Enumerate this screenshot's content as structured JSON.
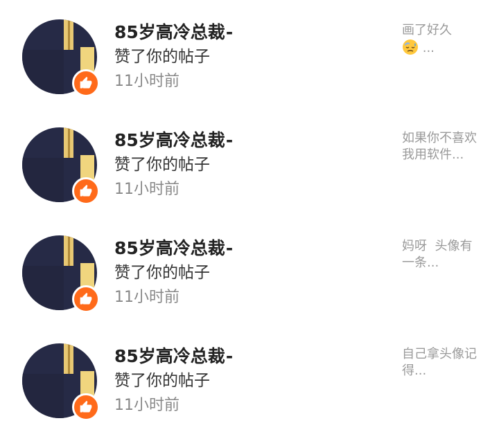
{
  "notifications": [
    {
      "user_name": "85岁高冷总裁⁃",
      "action": "赞了你的帖子",
      "time": "11小时前",
      "snippet_line1": "画了好久",
      "snippet_emoji": "sweat-face-icon",
      "snippet_tail": " ..."
    },
    {
      "user_name": "85岁高冷总裁⁃",
      "action": "赞了你的帖子",
      "time": "11小时前",
      "snippet_line1": "如果你不喜欢我用软件..."
    },
    {
      "user_name": "85岁高冷总裁⁃",
      "action": "赞了你的帖子",
      "time": "11小时前",
      "snippet_line1": "妈呀  头像有一条..."
    },
    {
      "user_name": "85岁高冷总裁⁃",
      "action": "赞了你的帖子",
      "time": "11小时前",
      "snippet_line1": "自己拿头像记得..."
    }
  ],
  "colors": {
    "badge": "#ff6a1a",
    "avatar_bg": "#262a46",
    "avatar_accent": "#e8c873"
  },
  "icons": {
    "badge": "thumbs-up-icon"
  }
}
